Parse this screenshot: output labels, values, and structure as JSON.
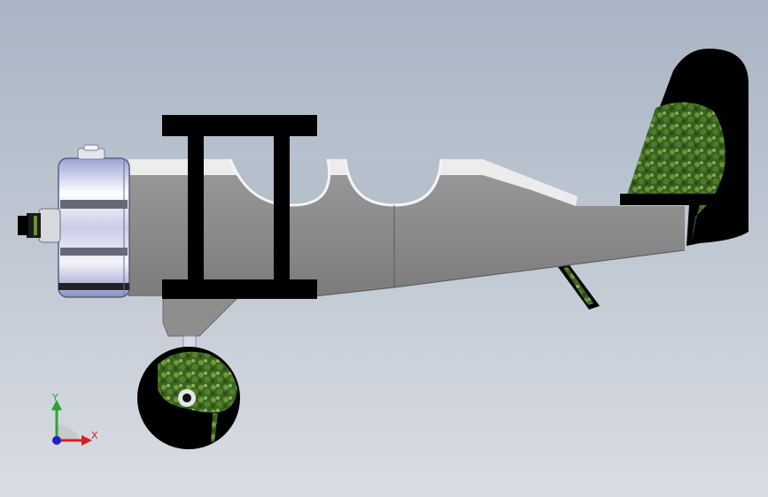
{
  "model": {
    "parts": [
      "propeller-hub",
      "engine-cowling",
      "fuel-cap",
      "fuselage",
      "upper-wing",
      "lower-wing",
      "wing-struts",
      "tail-fin",
      "horizontal-stabilizer",
      "tail-skid",
      "landing-gear-strut",
      "landing-gear-leg",
      "wheel"
    ],
    "fuselage_color": "#8c8c8c",
    "frame_color": "#000000",
    "texture_color": "#3f6b22"
  },
  "triad": {
    "x_label": "X",
    "y_label": "Y",
    "x_color": "#d32020",
    "y_color": "#2aa52a",
    "z_color": "#2020c8"
  }
}
